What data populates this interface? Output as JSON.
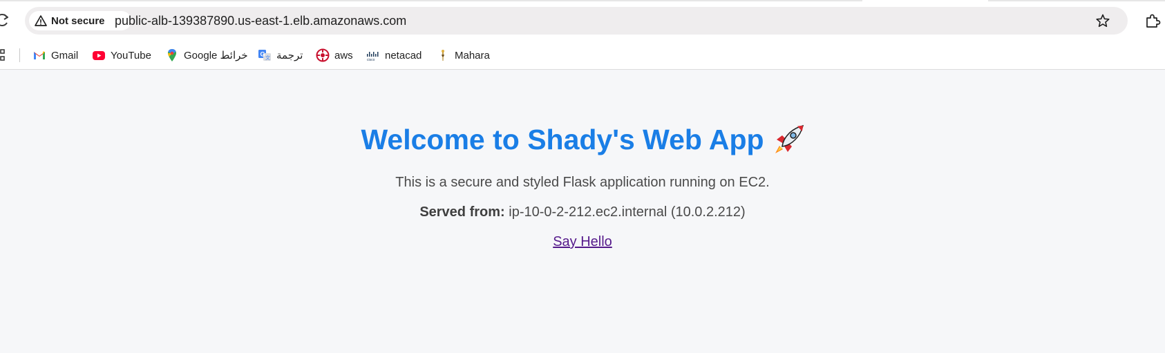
{
  "browser": {
    "security_chip": "Not secure",
    "url": "public-alb-139387890.us-east-1.elb.amazonaws.com",
    "icons": [
      "reload-icon",
      "warning-icon",
      "star-icon",
      "extensions-icon",
      "apps-grid-icon"
    ]
  },
  "bookmarks": [
    {
      "label": "Gmail",
      "icon": "gmail-icon"
    },
    {
      "label": "YouTube",
      "icon": "youtube-icon"
    },
    {
      "label": "Google خرائط",
      "icon": "google-maps-icon"
    },
    {
      "label": "ترجمة",
      "icon": "google-translate-icon"
    },
    {
      "label": "aws",
      "icon": "aws-icon"
    },
    {
      "label": "netacad",
      "icon": "cisco-icon"
    },
    {
      "label": "Mahara",
      "icon": "mahara-icon"
    }
  ],
  "page": {
    "title": "Welcome to Shady's Web App",
    "title_emoji": "rocket-icon",
    "description": "This is a secure and styled Flask application running on EC2.",
    "served_label": "Served from:",
    "served_value": "ip-10-0-2-212.ec2.internal (10.0.2.212)",
    "link": "Say Hello"
  },
  "colors": {
    "title": "#1a7ee6",
    "page_bg": "#f6f7f9",
    "link_visited": "#551a8b",
    "omnibox_bg": "#efedee"
  }
}
